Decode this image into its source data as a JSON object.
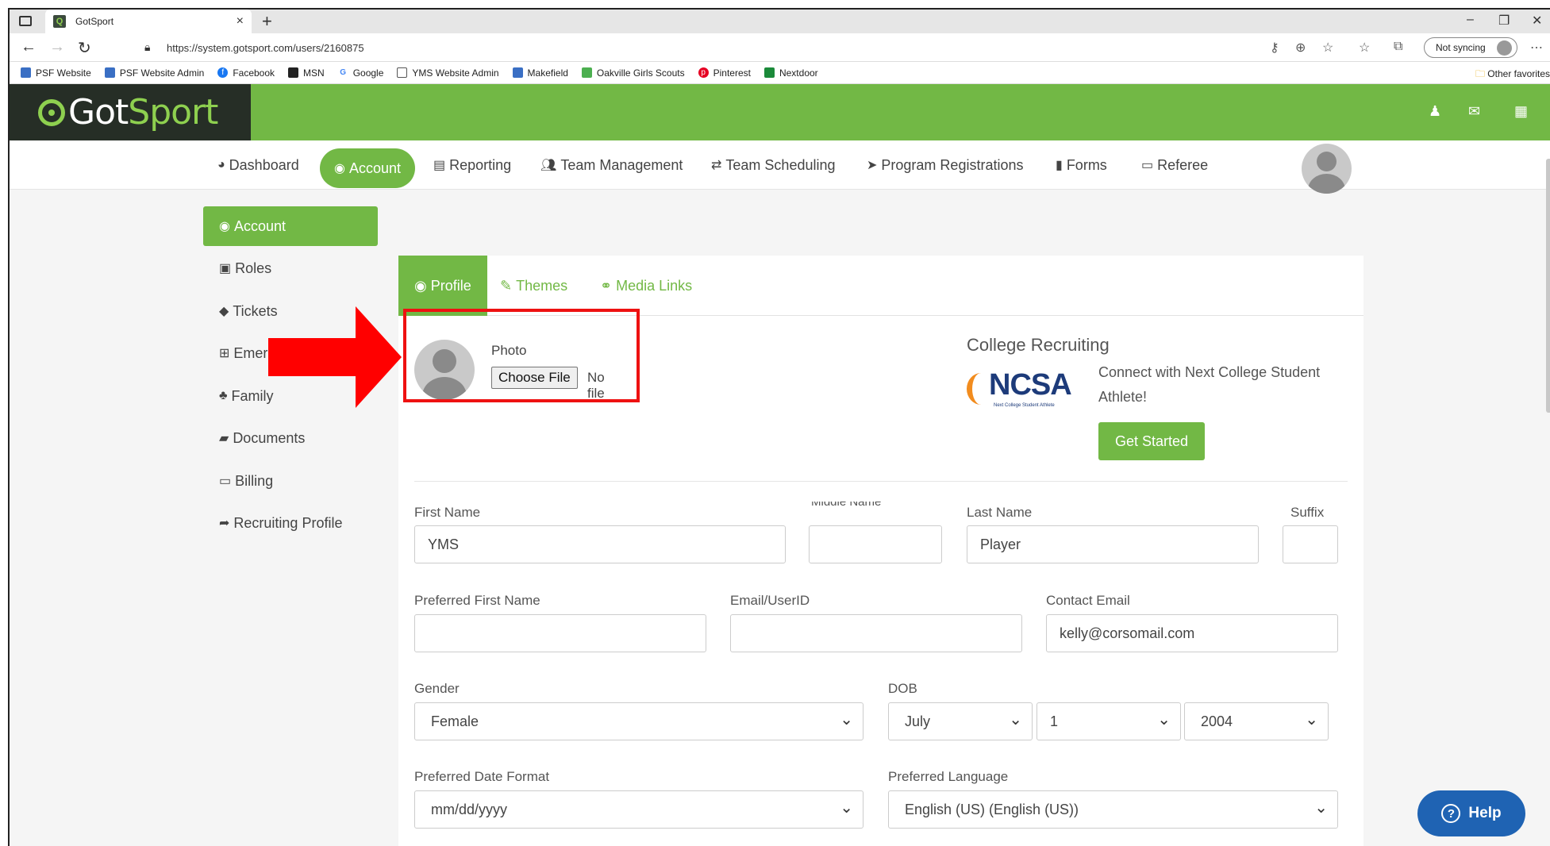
{
  "browser": {
    "tab_title": "GotSport",
    "url": "https://system.gotsport.com/users/2160875",
    "sync_label": "Not syncing",
    "favorites": [
      "PSF Website",
      "PSF Website Admin",
      "Facebook",
      "MSN",
      "Google",
      "YMS Website Admin",
      "Makefield",
      "Oakville Girls Scouts",
      "Pinterest",
      "Nextdoor"
    ],
    "other_favorites": "Other favorites"
  },
  "logo": {
    "part1": "Got",
    "part2": "Sport"
  },
  "nav": [
    "Dashboard",
    "Account",
    "Reporting",
    "Team Management",
    "Team Scheduling",
    "Program Registrations",
    "Forms",
    "Referee"
  ],
  "sidebar": [
    "Account",
    "Roles",
    "Tickets",
    "Emergency Info",
    "Family",
    "Documents",
    "Billing",
    "Recruiting Profile"
  ],
  "tabs": [
    "Profile",
    "Themes",
    "Media Links"
  ],
  "photo": {
    "label": "Photo",
    "button": "Choose File",
    "status": "No file"
  },
  "college": {
    "title": "College Recruiting",
    "logo_text": "NCSA",
    "logo_sub": "Next College Student Athlete",
    "text": "Connect with Next College Student Athlete!",
    "button": "Get Started"
  },
  "form": {
    "first_name": {
      "label": "First Name",
      "value": "YMS"
    },
    "middle_name": {
      "label": "Middle Name",
      "value": ""
    },
    "last_name": {
      "label": "Last Name",
      "value": "Player"
    },
    "suffix": {
      "label": "Suffix",
      "value": ""
    },
    "preferred_first_name": {
      "label": "Preferred First Name",
      "value": ""
    },
    "email_userid": {
      "label": "Email/UserID",
      "value": ""
    },
    "contact_email": {
      "label": "Contact Email",
      "value": "kelly@corsomail.com"
    },
    "gender": {
      "label": "Gender",
      "value": "Female"
    },
    "dob": {
      "label": "DOB",
      "month": "July",
      "day": "1",
      "year": "2004"
    },
    "date_format": {
      "label": "Preferred Date Format",
      "value": "mm/dd/yyyy"
    },
    "language": {
      "label": "Preferred Language",
      "value": "English (US) (English (US))"
    }
  },
  "help": "Help"
}
